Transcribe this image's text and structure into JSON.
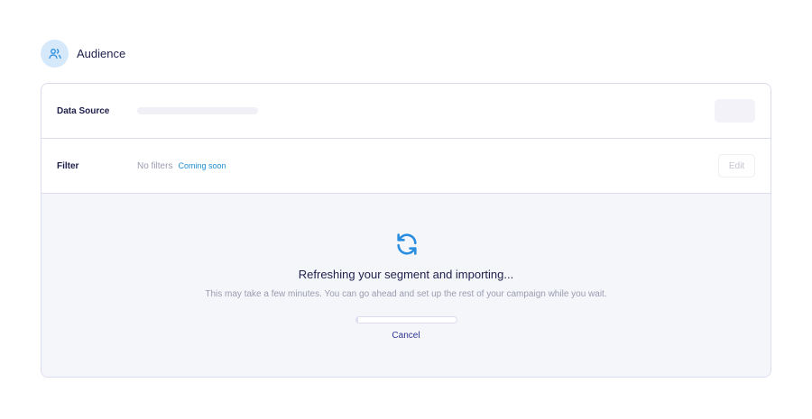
{
  "header": {
    "title": "Audience",
    "icon": "users-icon"
  },
  "rows": {
    "data_source": {
      "label": "Data Source"
    },
    "filter": {
      "label": "Filter",
      "value": "No filters",
      "badge": "Coming soon",
      "edit_label": "Edit"
    }
  },
  "status": {
    "heading": "Refreshing your segment and importing...",
    "message": "This may take a few minutes. You can go ahead and set up the rest of your campaign while you wait.",
    "progress_percent": 2,
    "cancel_label": "Cancel"
  },
  "colors": {
    "accent": "#1f8fd6",
    "text": "#1e1f4b"
  }
}
